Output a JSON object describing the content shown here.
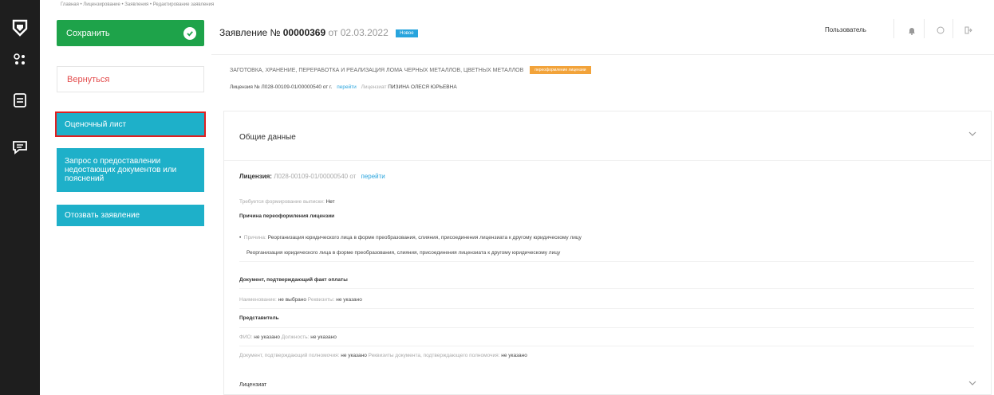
{
  "rail": {
    "icons": [
      "shield-logo-icon",
      "settings-nodes-icon",
      "document-icon",
      "chat-icon"
    ]
  },
  "breadcrumb": "Главная • Лицензирование • Заявления • Редактирование заявления",
  "actions": {
    "save": "Сохранить",
    "back": "Вернуться",
    "evaluation_sheet": "Оценочный лист",
    "request_docs": "Запрос о предоставлении недостающих документов или пояснений",
    "withdraw": "Отозвать заявление"
  },
  "header": {
    "title_prefix": "Заявление №",
    "number": "00000369",
    "date": "от 02.03.2022",
    "status": "Новое",
    "user": "Пользователь"
  },
  "license_info": {
    "activity": "ЗАГОТОВКА, ХРАНЕНИЕ, ПЕРЕРАБОТКА И РЕАЛИЗАЦИЯ ЛОМА ЧЕРНЫХ МЕТАЛЛОВ, ЦВЕТНЫХ МЕТАЛЛОВ",
    "activity_badge": "переоформление лицензии",
    "license_line": "Лицензия № Л028-00109-01/00000540 от г.",
    "license_link": "перейти",
    "licensee_label": "Лицензиат",
    "licensee": "ПИЗИНА ОЛЕСЯ ЮРЬЕВНА"
  },
  "panel": {
    "title": "Общие данные",
    "license_label": "Лицензия:",
    "license_value": "Л028-00109-01/00000540 от",
    "license_link": "перейти",
    "extract_label": "Требуется формирование выписки:",
    "extract_value": "Нет",
    "reason_heading": "Причина переоформления лицензии",
    "reason_label": "Причина:",
    "reason_value": "Реорганизация юридического лица в форме преобразования, слияния, присоединения лицензиата к другому юридическому лицу",
    "reason_detail": "Реорганизация юридического лица в форме преобразования, слияния, присоединения лицензиата к другому юридическому лицу",
    "payment_heading": "Документ, подтверждающий факт оплаты",
    "payment_name_label": "Наименование:",
    "payment_name_value": "не выбрано",
    "payment_req_label": "Реквизиты:",
    "payment_req_value": "не указано",
    "rep_heading": "Представитель",
    "rep_fio_label": "ФИО:",
    "rep_fio_value": "не указано",
    "rep_pos_label": "Должность:",
    "rep_pos_value": "не указано",
    "rep_doc_label": "Документ, подтверждающий полномочия:",
    "rep_doc_value": "не указано",
    "rep_docname_label": "Реквизиты документа, подтверждающего полномочия:",
    "rep_docname_value": "не указано",
    "licensee_section": "Лицензиат"
  }
}
